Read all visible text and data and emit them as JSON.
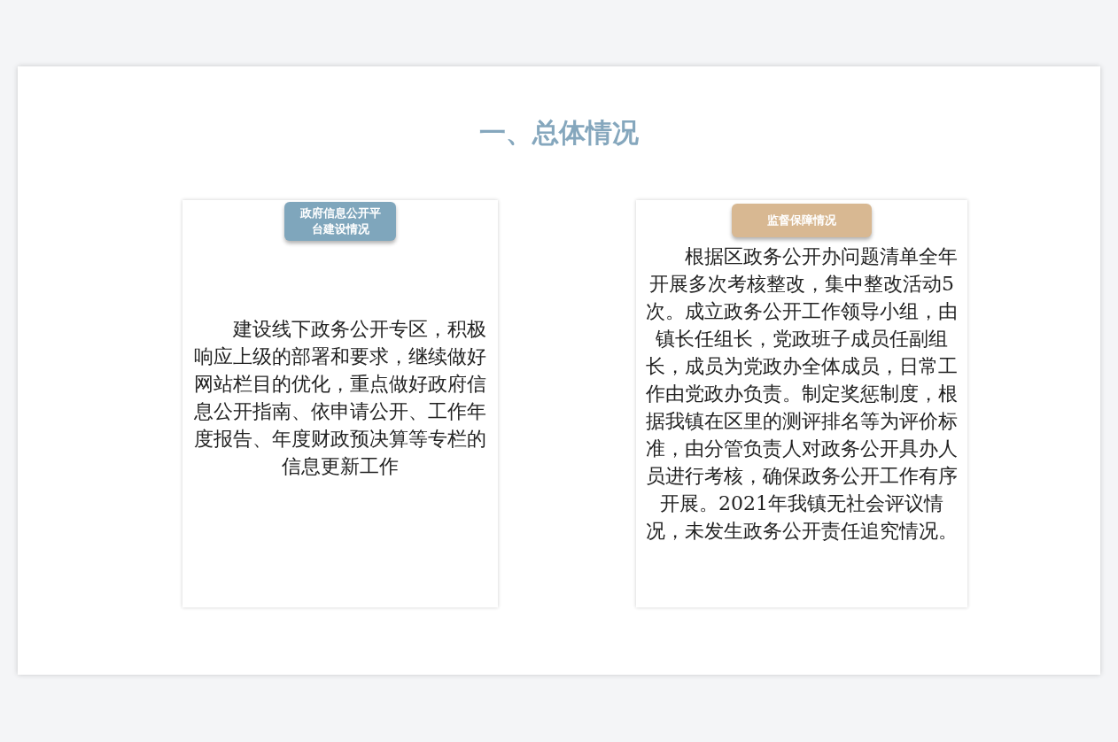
{
  "slide": {
    "title": "一、总体情况",
    "cards": [
      {
        "kind": "blue",
        "tag": "政府信息公开平台建设情况",
        "body": "建设线下政务公开专区，积极响应上级的部署和要求，继续做好网站栏目的优化，重点做好政府信息公开指南、依申请公开、工作年度报告、年度财政预决算等专栏的信息更新工作"
      },
      {
        "kind": "tan",
        "tag": "监督保障情况",
        "body": "根据区政务公开办问题清单全年开展多次考核整改，集中整改活动5次。成立政务公开工作领导小组，由镇长任组长，党政班子成员任副组长，成员为党政办全体成员，日常工作由党政办负责。制定奖惩制度，根据我镇在区里的测评排名等为评价标准，由分管负责人对政务公开具办人员进行考核，确保政务公开工作有序开展。2021年我镇无社会评议情况，未发生政务公开责任追究情况。"
      }
    ]
  }
}
